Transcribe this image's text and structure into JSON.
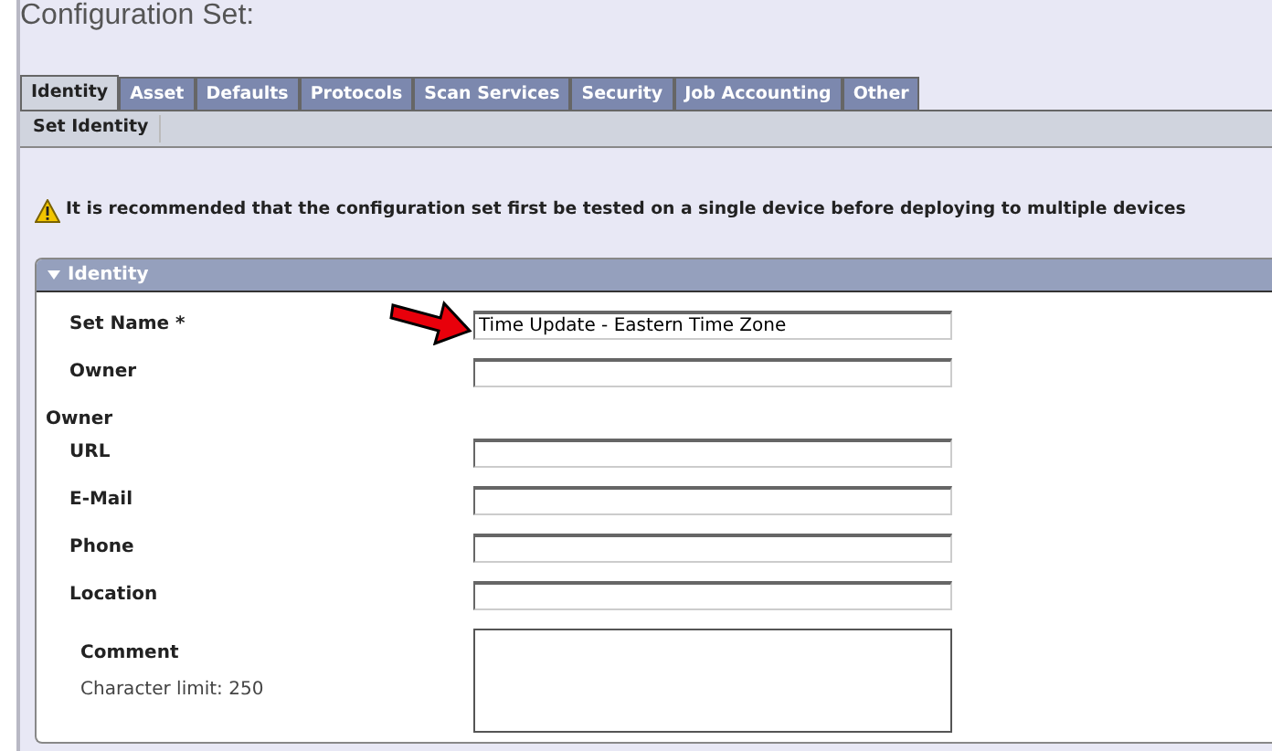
{
  "title": "Configuration Set:",
  "tabs": [
    {
      "label": "Identity",
      "selected": true
    },
    {
      "label": "Asset",
      "selected": false
    },
    {
      "label": "Defaults",
      "selected": false
    },
    {
      "label": "Protocols",
      "selected": false
    },
    {
      "label": "Scan Services",
      "selected": false
    },
    {
      "label": "Security",
      "selected": false
    },
    {
      "label": "Job Accounting",
      "selected": false
    },
    {
      "label": "Other",
      "selected": false
    }
  ],
  "subnav": [
    {
      "label": "Set Identity"
    }
  ],
  "warning": "It is recommended that the configuration set first be tested on a single device before deploying to multiple devices",
  "panel": {
    "title": "Identity",
    "expanded": true,
    "fields": [
      {
        "kind": "text",
        "label": "Set Name *",
        "value": "Time Update - Eastern Time Zone",
        "highlighted": true
      },
      {
        "kind": "text",
        "label": "Owner"
      },
      {
        "kind": "heading",
        "label": "Owner"
      },
      {
        "kind": "text",
        "label": "URL"
      },
      {
        "kind": "text",
        "label": "E-Mail"
      },
      {
        "kind": "text",
        "label": "Phone"
      },
      {
        "kind": "text",
        "label": "Location"
      },
      {
        "kind": "textarea",
        "label": "Comment",
        "note": "Character limit: 250"
      }
    ]
  }
}
